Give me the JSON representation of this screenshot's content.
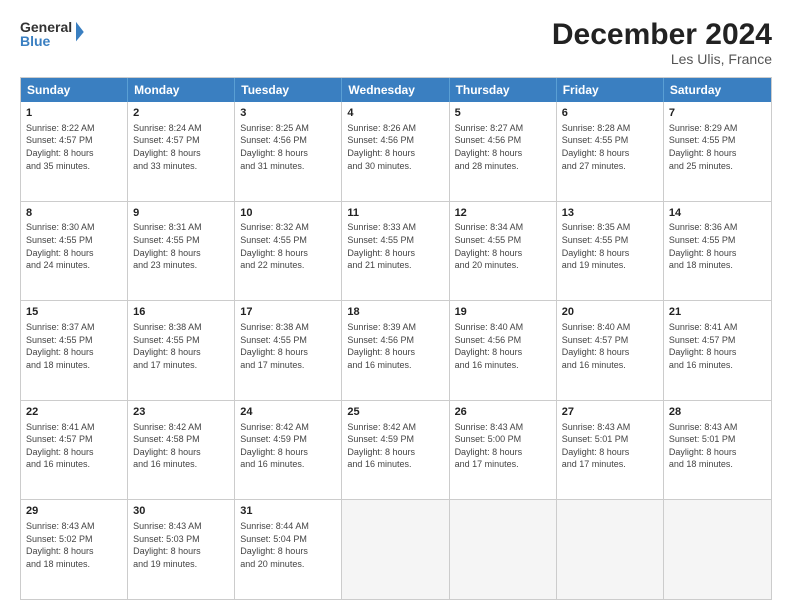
{
  "header": {
    "logo_line1": "General",
    "logo_line2": "Blue",
    "title": "December 2024",
    "subtitle": "Les Ulis, France"
  },
  "days_of_week": [
    "Sunday",
    "Monday",
    "Tuesday",
    "Wednesday",
    "Thursday",
    "Friday",
    "Saturday"
  ],
  "weeks": [
    [
      {
        "day": "1",
        "info": "Sunrise: 8:22 AM\nSunset: 4:57 PM\nDaylight: 8 hours\nand 35 minutes."
      },
      {
        "day": "2",
        "info": "Sunrise: 8:24 AM\nSunset: 4:57 PM\nDaylight: 8 hours\nand 33 minutes."
      },
      {
        "day": "3",
        "info": "Sunrise: 8:25 AM\nSunset: 4:56 PM\nDaylight: 8 hours\nand 31 minutes."
      },
      {
        "day": "4",
        "info": "Sunrise: 8:26 AM\nSunset: 4:56 PM\nDaylight: 8 hours\nand 30 minutes."
      },
      {
        "day": "5",
        "info": "Sunrise: 8:27 AM\nSunset: 4:56 PM\nDaylight: 8 hours\nand 28 minutes."
      },
      {
        "day": "6",
        "info": "Sunrise: 8:28 AM\nSunset: 4:55 PM\nDaylight: 8 hours\nand 27 minutes."
      },
      {
        "day": "7",
        "info": "Sunrise: 8:29 AM\nSunset: 4:55 PM\nDaylight: 8 hours\nand 25 minutes."
      }
    ],
    [
      {
        "day": "8",
        "info": "Sunrise: 8:30 AM\nSunset: 4:55 PM\nDaylight: 8 hours\nand 24 minutes."
      },
      {
        "day": "9",
        "info": "Sunrise: 8:31 AM\nSunset: 4:55 PM\nDaylight: 8 hours\nand 23 minutes."
      },
      {
        "day": "10",
        "info": "Sunrise: 8:32 AM\nSunset: 4:55 PM\nDaylight: 8 hours\nand 22 minutes."
      },
      {
        "day": "11",
        "info": "Sunrise: 8:33 AM\nSunset: 4:55 PM\nDaylight: 8 hours\nand 21 minutes."
      },
      {
        "day": "12",
        "info": "Sunrise: 8:34 AM\nSunset: 4:55 PM\nDaylight: 8 hours\nand 20 minutes."
      },
      {
        "day": "13",
        "info": "Sunrise: 8:35 AM\nSunset: 4:55 PM\nDaylight: 8 hours\nand 19 minutes."
      },
      {
        "day": "14",
        "info": "Sunrise: 8:36 AM\nSunset: 4:55 PM\nDaylight: 8 hours\nand 18 minutes."
      }
    ],
    [
      {
        "day": "15",
        "info": "Sunrise: 8:37 AM\nSunset: 4:55 PM\nDaylight: 8 hours\nand 18 minutes."
      },
      {
        "day": "16",
        "info": "Sunrise: 8:38 AM\nSunset: 4:55 PM\nDaylight: 8 hours\nand 17 minutes."
      },
      {
        "day": "17",
        "info": "Sunrise: 8:38 AM\nSunset: 4:55 PM\nDaylight: 8 hours\nand 17 minutes."
      },
      {
        "day": "18",
        "info": "Sunrise: 8:39 AM\nSunset: 4:56 PM\nDaylight: 8 hours\nand 16 minutes."
      },
      {
        "day": "19",
        "info": "Sunrise: 8:40 AM\nSunset: 4:56 PM\nDaylight: 8 hours\nand 16 minutes."
      },
      {
        "day": "20",
        "info": "Sunrise: 8:40 AM\nSunset: 4:57 PM\nDaylight: 8 hours\nand 16 minutes."
      },
      {
        "day": "21",
        "info": "Sunrise: 8:41 AM\nSunset: 4:57 PM\nDaylight: 8 hours\nand 16 minutes."
      }
    ],
    [
      {
        "day": "22",
        "info": "Sunrise: 8:41 AM\nSunset: 4:57 PM\nDaylight: 8 hours\nand 16 minutes."
      },
      {
        "day": "23",
        "info": "Sunrise: 8:42 AM\nSunset: 4:58 PM\nDaylight: 8 hours\nand 16 minutes."
      },
      {
        "day": "24",
        "info": "Sunrise: 8:42 AM\nSunset: 4:59 PM\nDaylight: 8 hours\nand 16 minutes."
      },
      {
        "day": "25",
        "info": "Sunrise: 8:42 AM\nSunset: 4:59 PM\nDaylight: 8 hours\nand 16 minutes."
      },
      {
        "day": "26",
        "info": "Sunrise: 8:43 AM\nSunset: 5:00 PM\nDaylight: 8 hours\nand 17 minutes."
      },
      {
        "day": "27",
        "info": "Sunrise: 8:43 AM\nSunset: 5:01 PM\nDaylight: 8 hours\nand 17 minutes."
      },
      {
        "day": "28",
        "info": "Sunrise: 8:43 AM\nSunset: 5:01 PM\nDaylight: 8 hours\nand 18 minutes."
      }
    ],
    [
      {
        "day": "29",
        "info": "Sunrise: 8:43 AM\nSunset: 5:02 PM\nDaylight: 8 hours\nand 18 minutes."
      },
      {
        "day": "30",
        "info": "Sunrise: 8:43 AM\nSunset: 5:03 PM\nDaylight: 8 hours\nand 19 minutes."
      },
      {
        "day": "31",
        "info": "Sunrise: 8:44 AM\nSunset: 5:04 PM\nDaylight: 8 hours\nand 20 minutes."
      },
      {
        "day": "",
        "info": ""
      },
      {
        "day": "",
        "info": ""
      },
      {
        "day": "",
        "info": ""
      },
      {
        "day": "",
        "info": ""
      }
    ]
  ]
}
